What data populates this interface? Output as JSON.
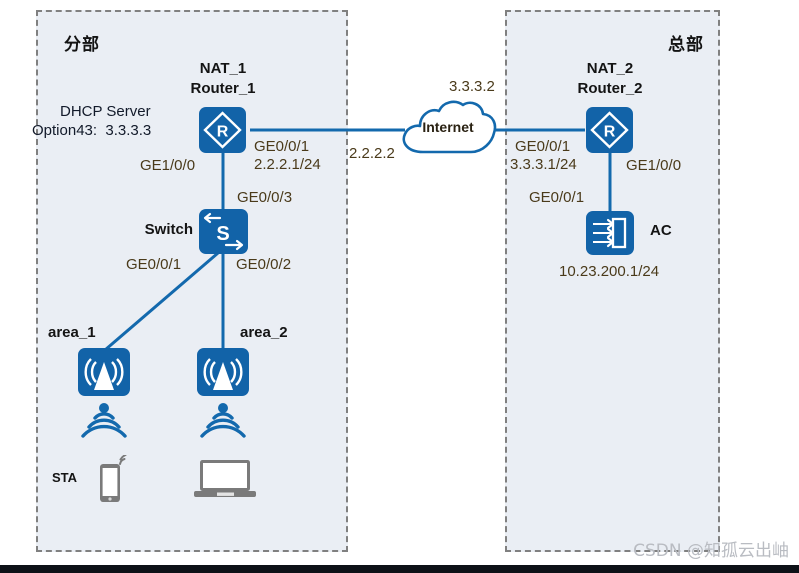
{
  "diagram": {
    "title_branch": "分部",
    "title_hq": "总部",
    "watermark": "CSDN @知孤云出岫"
  },
  "colors": {
    "device_blue": "#1263a8",
    "link_blue": "#1369ad",
    "zone_fill": "#eaeef4",
    "zone_border": "#808080",
    "iface_text": "#4a3a1a",
    "terminal_gray": "#7a7a7a"
  },
  "nodes": {
    "router1": {
      "name_top": "NAT_1",
      "name_bottom": "Router_1",
      "icon": "router-icon"
    },
    "router2": {
      "name_top": "NAT_2",
      "name_bottom": "Router_2",
      "icon": "router-icon"
    },
    "switch": {
      "label": "Switch",
      "icon": "switch-icon"
    },
    "ac": {
      "label": "AC",
      "icon": "ac-icon",
      "ip": "10.23.200.1/24"
    },
    "ap1": {
      "label": "area_1",
      "icon": "access-point-icon"
    },
    "ap2": {
      "label": "area_2",
      "icon": "access-point-icon"
    },
    "internet": {
      "label": "Internet",
      "icon": "cloud-icon"
    },
    "sta": {
      "label": "STA",
      "icon": "smartphone-icon"
    },
    "laptop": {
      "icon": "laptop-icon"
    }
  },
  "annotations": {
    "dhcp_line1": "DHCP Server",
    "dhcp_line2": "Option43:  3.3.3.3",
    "r1_ge0_0_1": "GE0/0/1",
    "r1_ip": "2.2.2.1/24",
    "r1_ge1_0_0": "GE1/0/0",
    "wan_ip_left": "2.2.2.2",
    "wan_ip_right": "3.3.3.2",
    "r2_ge0_0_1": "GE0/0/1",
    "r2_ip": "3.3.3.1/24",
    "r2_ge1_0_0": "GE1/0/0",
    "ac_ge0_0_1": "GE0/0/1",
    "ac_ip": "10.23.200.1/24",
    "sw_ge0_0_3": "GE0/0/3",
    "sw_ge0_0_1": "GE0/0/1",
    "sw_ge0_0_2": "GE0/0/2"
  }
}
